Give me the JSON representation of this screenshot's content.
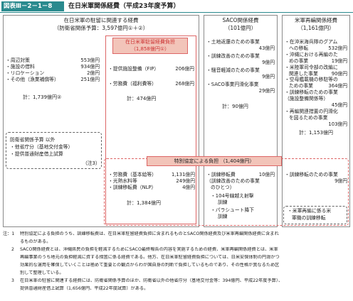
{
  "figure": {
    "tag": "図表Ⅲ－2－1－8",
    "title": "在日米軍関係経費（平成23年度予算）"
  },
  "left": {
    "header": [
      "在日米軍の駐留に関連する経費",
      "（防衛省関係予算：3,597億円①＋②）"
    ],
    "items": [
      {
        "label": "・周辺対策",
        "value": "553億円"
      },
      {
        "label": "・施設の借料",
        "value": "934億円"
      },
      {
        "label": "・リロケーション",
        "value": "2億円"
      },
      {
        "label": "・その他（漁業補償等）",
        "value": "251億円"
      }
    ],
    "total": "計：1,739億円②",
    "sub": {
      "lines": [
        "防衛省関係予算 以外",
        "・他省庁分（基地交付金等）",
        "・提供普通財産借上試算"
      ],
      "note": "（注3）"
    }
  },
  "host_nation": {
    "header": [
      "在日米軍駐留経費負担",
      "（1,858億円①）"
    ],
    "items": [
      {
        "label": "・提供施設整備（FIP）",
        "value": "206億円"
      },
      {
        "label": "・労務費（福利費等）",
        "value": "268億円"
      }
    ],
    "total": "計：474億円"
  },
  "special": {
    "header": "特別協定による負担 （1,404億円）",
    "items": [
      {
        "label": "・労務費（基本給等）",
        "value": "1,131億円"
      },
      {
        "label": "・光熱水料等",
        "value": "249億円"
      },
      {
        "label": "・訓練移転費（NLP）",
        "value": "4億円"
      }
    ],
    "total": "計：1,384億円"
  },
  "saco": {
    "header": [
      "SACO関係経費",
      "（101億円）"
    ],
    "items": [
      {
        "label": "・土地返還のための事業",
        "value": "43億円"
      },
      {
        "label": "・訓練改善のための事業",
        "value": "9億円"
      },
      {
        "label": "・騒音軽減のための事業",
        "value": "9億円"
      },
      {
        "label": "・SACO事業円滑化事業",
        "value": "29億円"
      }
    ],
    "total": "計：90億円",
    "special_items": [
      {
        "label": "・訓練移転費",
        "value": "10億円"
      },
      {
        "label": "（訓練改善のための事業",
        "value": ""
      },
      {
        "label": "のひとつ）",
        "value": ""
      },
      {
        "label": "・104号線越え射撃",
        "value": ""
      },
      {
        "label": "訓練",
        "value": ""
      },
      {
        "label": "・パラシュート降下",
        "value": ""
      },
      {
        "label": "訓練",
        "value": ""
      }
    ]
  },
  "realign": {
    "header": [
      "米軍再編関係経費",
      "（1,161億円）"
    ],
    "items": [
      {
        "label": "・在沖米海兵隊のグアム",
        "value": ""
      },
      {
        "label": "への移転",
        "value": "532億円"
      },
      {
        "label": "・沖縄における再編のた",
        "value": ""
      },
      {
        "label": "めの事業",
        "value": "19億円"
      },
      {
        "label": "・米陸軍司令部の改編に",
        "value": ""
      },
      {
        "label": "関連した事業",
        "value": "90億円"
      },
      {
        "label": "・空母艦載機の移駐等の",
        "value": ""
      },
      {
        "label": "ための事業",
        "value": "364億円"
      },
      {
        "label": "・訓練移転のための事業",
        "value": ""
      },
      {
        "label": "（施設整備関係等）",
        "value": ""
      },
      {
        "label": "",
        "value": "45億円"
      },
      {
        "label": "・再編関連措置の円滑化",
        "value": ""
      },
      {
        "label": "を図るための事業",
        "value": ""
      },
      {
        "label": "",
        "value": "103億円"
      }
    ],
    "total": "計：1,153億円",
    "special_items": [
      {
        "label": "・訓練移転のための事業",
        "value": ""
      },
      {
        "label": "",
        "value": "9億円"
      }
    ],
    "extra": [
      "・米軍再編に係る米",
      "軍機の訓練移転"
    ]
  },
  "notes": [
    {
      "no": "注：1",
      "text": "特別協定による負担のうち、訓練移転費は、在日米軍駐留経費負担に含まれるものとSACO関係経費及び米軍再編関係経費に含まれ"
    },
    {
      "no": "",
      "text": "るものがある。"
    },
    {
      "no": "2",
      "text": "SACO関係経費とは、沖縄県民の負担を軽減するためにSACO最終報告の内容を実施するための経費、米軍再編関係経費とは、米軍"
    },
    {
      "no": "",
      "text": "再編事業のうち地元の負担軽減に資する措置に係る経費である。他方、在日米軍駐留経費負担については、日米安保体制の円滑かつ"
    },
    {
      "no": "",
      "text": "効果的な運用を確保していくことは極めて重要との観点からわが国自身の判断で負担しているものであり、その性格が異なるため区"
    },
    {
      "no": "",
      "text": "別して整理している。"
    },
    {
      "no": "3",
      "text": "在日米軍の駐留に関連する経費には、防衛省関係予算のほか、防衛省以外の他省庁分（基地交付金等：394億円、平成22年度予算）、"
    },
    {
      "no": "",
      "text": "提供普通財産借上試算（1,656億円、平成22年度試算）がある。"
    }
  ]
}
